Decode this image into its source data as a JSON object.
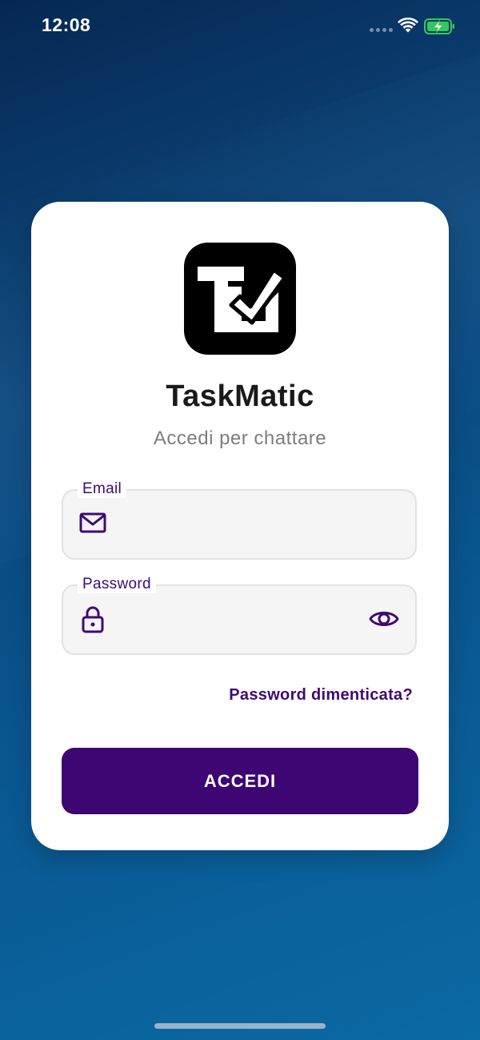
{
  "status_bar": {
    "time": "12:08",
    "signal_icon": "signal-dots-icon",
    "wifi_icon": "wifi-icon",
    "battery_icon": "battery-charging-icon",
    "battery_color": "#34c759"
  },
  "login_card": {
    "logo_icon": "taskmatic-logo-icon",
    "title": "TaskMatic",
    "subtitle": "Accedi per chattare",
    "email": {
      "label": "Email",
      "value": "",
      "icon": "mail-icon"
    },
    "password": {
      "label": "Password",
      "value": "",
      "icon": "lock-icon",
      "toggle_icon": "eye-icon"
    },
    "forgot_password": "Password dimenticata?",
    "submit_label": "ACCEDI"
  },
  "colors": {
    "accent": "#3d0673",
    "label": "#3f0a74",
    "field_background": "#f5f5f5",
    "field_border": "#e2e2e2",
    "card_background": "#ffffff"
  }
}
